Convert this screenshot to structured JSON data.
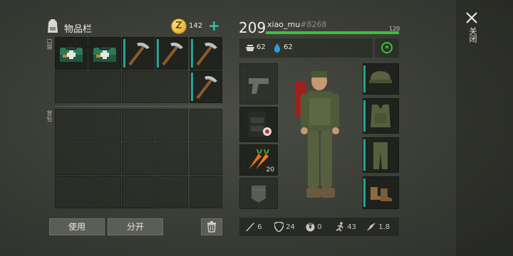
{
  "inventory": {
    "title": "物品栏",
    "coins": "142",
    "add_label": "+",
    "pocket_label": "口袋",
    "backpack_label": "背包",
    "items": [
      "medkit",
      "medkit",
      "pickaxe",
      "pickaxe",
      "pickaxe",
      "pickaxe"
    ]
  },
  "buttons": {
    "use": "使用",
    "split": "分开"
  },
  "player": {
    "level": "209",
    "name": "xiao_mu",
    "tag": "#8268",
    "hp_max": "120",
    "hp_fraction": 1.0,
    "food": "62",
    "water": "62"
  },
  "equipment": {
    "carrots_count": "20",
    "slots": [
      "pistol",
      "backpack",
      "carrot",
      "pocket",
      "cap",
      "vest",
      "pants",
      "boots"
    ]
  },
  "stats": {
    "attack": "6",
    "defense": "24",
    "radiation": "0",
    "speed": "43",
    "weight": "1.8"
  },
  "close_label": "关闭",
  "colors": {
    "accent": "#2ec4a8",
    "hp": "#3fbf3f",
    "water": "#2a9ddf"
  }
}
